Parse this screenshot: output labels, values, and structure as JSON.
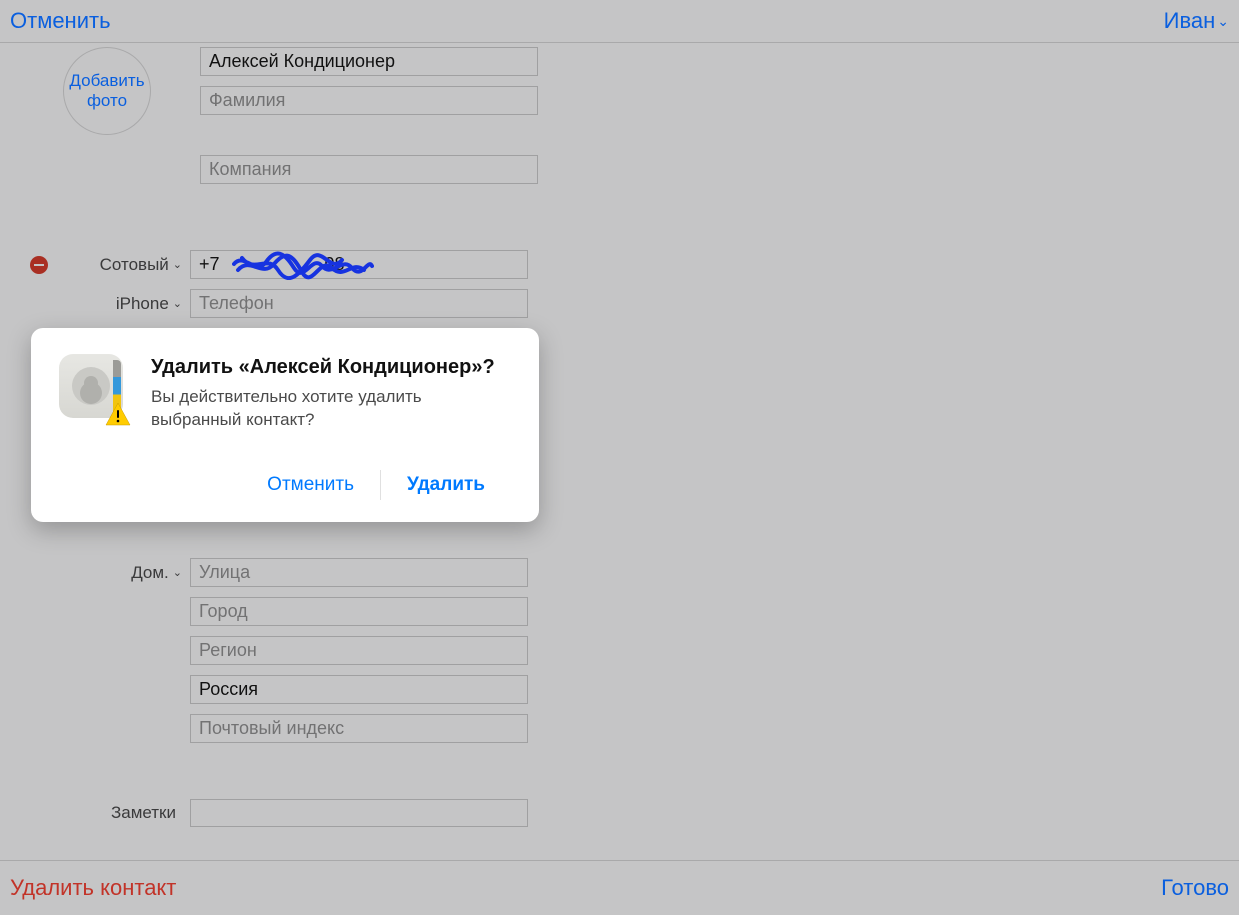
{
  "topbar": {
    "cancel_label": "Отменить",
    "user_label": "Иван"
  },
  "photo_button": {
    "line1": "Добавить",
    "line2": "фото"
  },
  "name": {
    "first_value": "Алексей Кондиционер",
    "last_placeholder": "Фамилия",
    "company_placeholder": "Компания"
  },
  "phones": {
    "mobile_label": "Сотовый",
    "mobile_value_prefix": "+7",
    "mobile_value_suffix": "08",
    "iphone_label": "iPhone",
    "iphone_placeholder": "Телефон"
  },
  "address": {
    "home_label": "Дом.",
    "street_placeholder": "Улица",
    "city_placeholder": "Город",
    "region_placeholder": "Регион",
    "country_value": "Россия",
    "zip_placeholder": "Почтовый индекс"
  },
  "notes": {
    "label": "Заметки"
  },
  "footer": {
    "delete_label": "Удалить контакт",
    "done_label": "Готово"
  },
  "dialog": {
    "title": "Удалить «Алексей Кондиционер»?",
    "message": "Вы действительно хотите удалить выбранный контакт?",
    "cancel": "Отменить",
    "confirm": "Удалить"
  }
}
